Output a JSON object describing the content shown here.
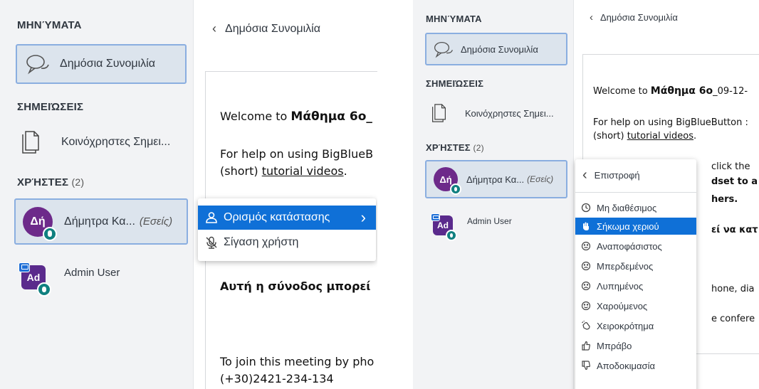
{
  "left": {
    "messages_title": "ΜΗΝΎΜΑΤΑ",
    "public_chat": "Δημόσια Συνομιλία",
    "notes_title": "ΣΗΜΕΙΏΣΕΙΣ",
    "shared_notes": "Κοινόχρηστες Σημει...",
    "users_title": "ΧΡΉΣΤΕΣ",
    "users_count": "(2)",
    "user1_initials": "Δή",
    "user1_name": "Δήμητρα Κα...",
    "user1_you": "(Εσείς)",
    "user2_initials": "Ad",
    "user2_name": "Admin User",
    "chat_header": "Δημόσια Συνομιλία",
    "welcome_prefix": "Welcome to ",
    "welcome_bold": "Μάθημα 6ο_",
    "help_text": "For help on using BigBlueB",
    "help_short": "(short) ",
    "help_link": "tutorial videos",
    "help_end": ".",
    "session_bold": "Αυτή η σύνοδος μπορεί",
    "phone_text": "To join this meeting by pho",
    "phone_number": "(+30)2421-234-134",
    "menu": {
      "set_status": "Ορισμός κατάστασης",
      "mute_user": "Σίγαση χρήστη"
    }
  },
  "right": {
    "messages_title": "ΜΗΝΎΜΑΤΑ",
    "public_chat": "Δημόσια Συνομιλία",
    "notes_title": "ΣΗΜΕΙΏΣΕΙΣ",
    "shared_notes": "Κοινόχρηστες Σημει...",
    "users_title": "ΧΡΉΣΤΕΣ",
    "users_count": "(2)",
    "user1_initials": "Δή",
    "user1_name": "Δήμητρα Κα...",
    "user1_you": "(Εσείς)",
    "user2_initials": "Ad",
    "user2_name": "Admin User",
    "chat_header": "Δημόσια Συνομιλία",
    "welcome_prefix": "Welcome to ",
    "welcome_bold": "Μάθημα 6ο",
    "welcome_rest": "_09-12-",
    "help_text": "For help on using BigBlueButton :",
    "help_short": "(short) ",
    "help_link": "tutorial videos",
    "help_end": ".",
    "frag1": "click the",
    "frag2": "dset to a",
    "frag3": "hers.",
    "frag4": "εί να κατ",
    "frag5": "hone, dia",
    "frag6": "e confere",
    "status_menu": {
      "back": "Επιστροφή",
      "items": [
        "Μη διαθέσιμος",
        "Σήκωμα χεριού",
        "Αναποφάσιστος",
        "Μπερδεμένος",
        "Λυπημένος",
        "Χαρούμενος",
        "Χειροκρότημα",
        "Μπράβο",
        "Αποδοκιμασία"
      ]
    }
  },
  "colors": {
    "highlight": "#0f70d7",
    "active_border": "#8aaee0",
    "avatar_purple": "#6d2a8a",
    "mic_teal": "#108080"
  }
}
